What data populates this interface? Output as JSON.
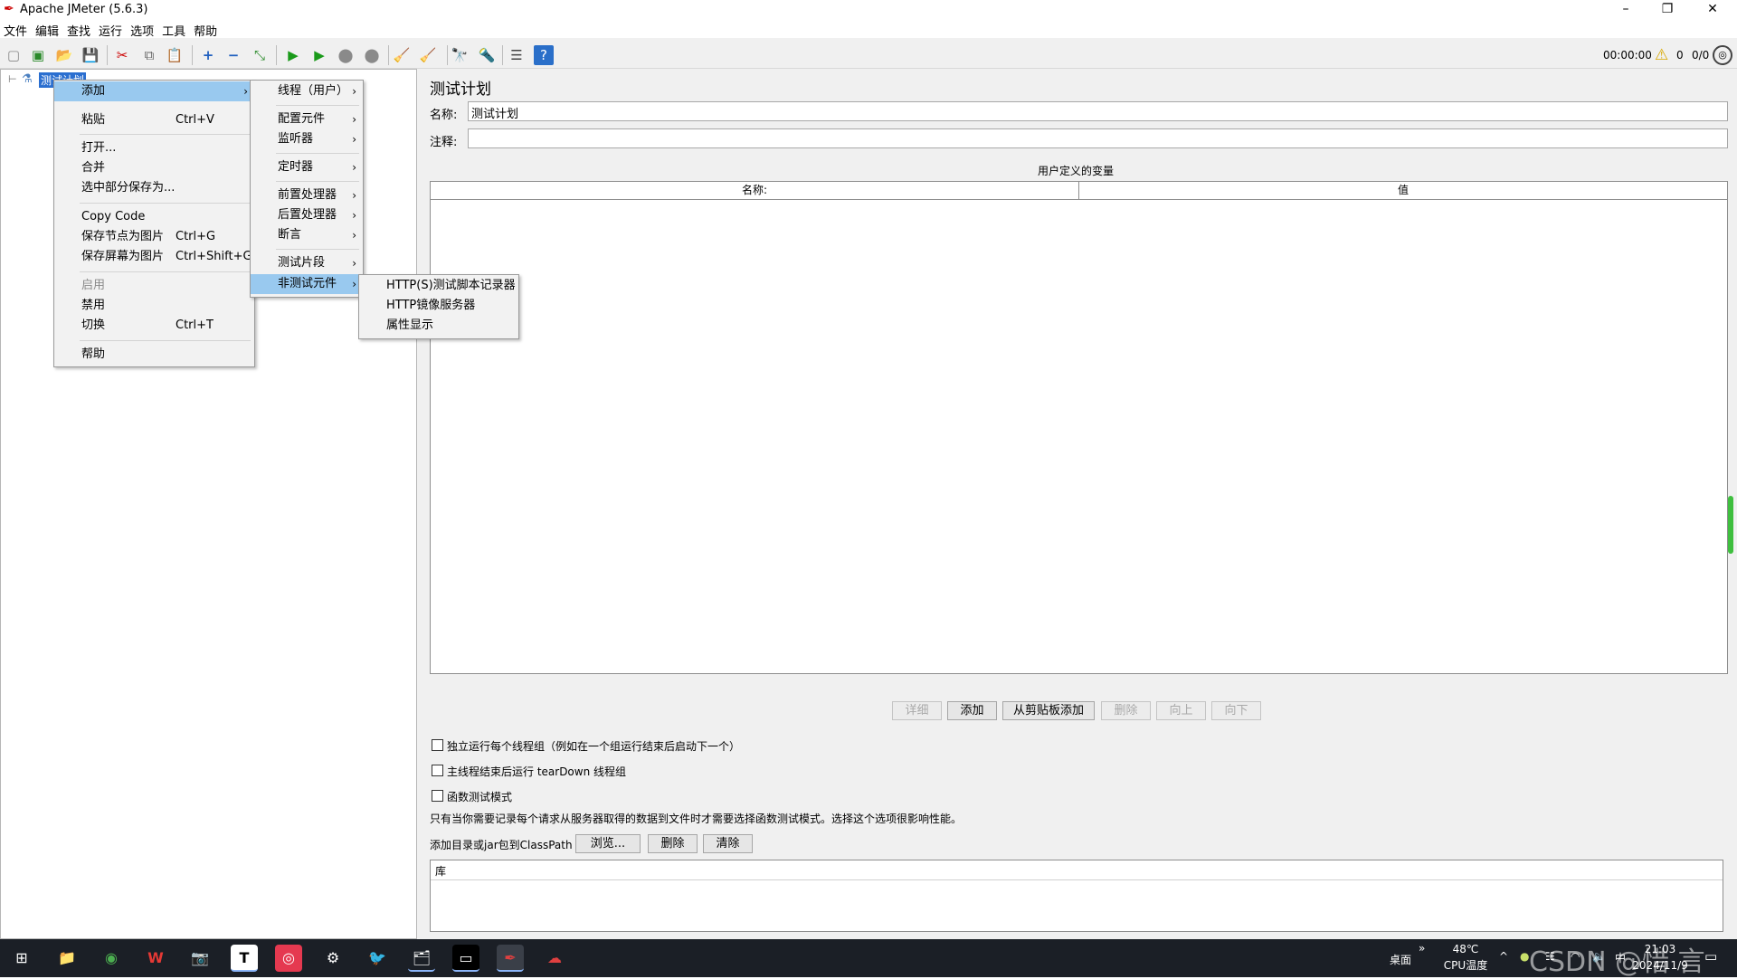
{
  "window": {
    "title": "Apache JMeter (5.6.3)",
    "minimize": "–",
    "maximize": "❐",
    "close": "✕"
  },
  "menubar": [
    "文件",
    "编辑",
    "查找",
    "运行",
    "选项",
    "工具",
    "帮助"
  ],
  "toolbar": {
    "timer": "00:00:00",
    "warning_count": "0",
    "threads": "0/0"
  },
  "tree": {
    "root_label": "测试计划"
  },
  "context_menu": {
    "items": [
      {
        "label": "添加",
        "submenu": true
      },
      {
        "label": "粘贴",
        "shortcut": "Ctrl+V"
      },
      {
        "label": "打开..."
      },
      {
        "label": "合并"
      },
      {
        "label": "选中部分保存为..."
      },
      {
        "label": "Copy Code"
      },
      {
        "label": "保存节点为图片",
        "shortcut": "Ctrl+G"
      },
      {
        "label": "保存屏幕为图片",
        "shortcut": "Ctrl+Shift+G"
      },
      {
        "label": "启用",
        "disabled": true
      },
      {
        "label": "禁用"
      },
      {
        "label": "切换",
        "shortcut": "Ctrl+T"
      },
      {
        "label": "帮助"
      }
    ]
  },
  "add_submenu": {
    "items": [
      "线程（用户）",
      "配置元件",
      "监听器",
      "定时器",
      "前置处理器",
      "后置处理器",
      "断言",
      "测试片段",
      "非测试元件"
    ]
  },
  "nontest_submenu": {
    "items": [
      "HTTP(S)测试脚本记录器",
      "HTTP镜像服务器",
      "属性显示"
    ]
  },
  "panel": {
    "title": "测试计划",
    "name_label": "名称:",
    "name_value": "测试计划",
    "comment_label": "注释:",
    "comment_value": "",
    "vars_title": "用户定义的变量",
    "col_name": "名称:",
    "col_value": "值",
    "buttons": {
      "detail": "详细",
      "add": "添加",
      "add_clipboard": "从剪贴板添加",
      "delete": "删除",
      "up": "向上",
      "down": "向下"
    },
    "chk_serial": "独立运行每个线程组（例如在一个组运行结束后启动下一个）",
    "chk_teardown": "主线程结束后运行 tearDown 线程组",
    "chk_functional": "函数测试模式",
    "functional_note": "只有当你需要记录每个请求从服务器取得的数据到文件时才需要选择函数测试模式。选择这个选项很影响性能。",
    "classpath_label": "添加目录或jar包到ClassPath",
    "browse": "浏览...",
    "cp_delete": "删除",
    "cp_clear": "清除",
    "lib_header": "库"
  },
  "taskbar": {
    "desktop": "桌面",
    "temp": "48℃",
    "temp_label": "CPU温度",
    "date": "2024/11/9",
    "time": "21:03",
    "watermark": "CSDN @惜 言"
  }
}
